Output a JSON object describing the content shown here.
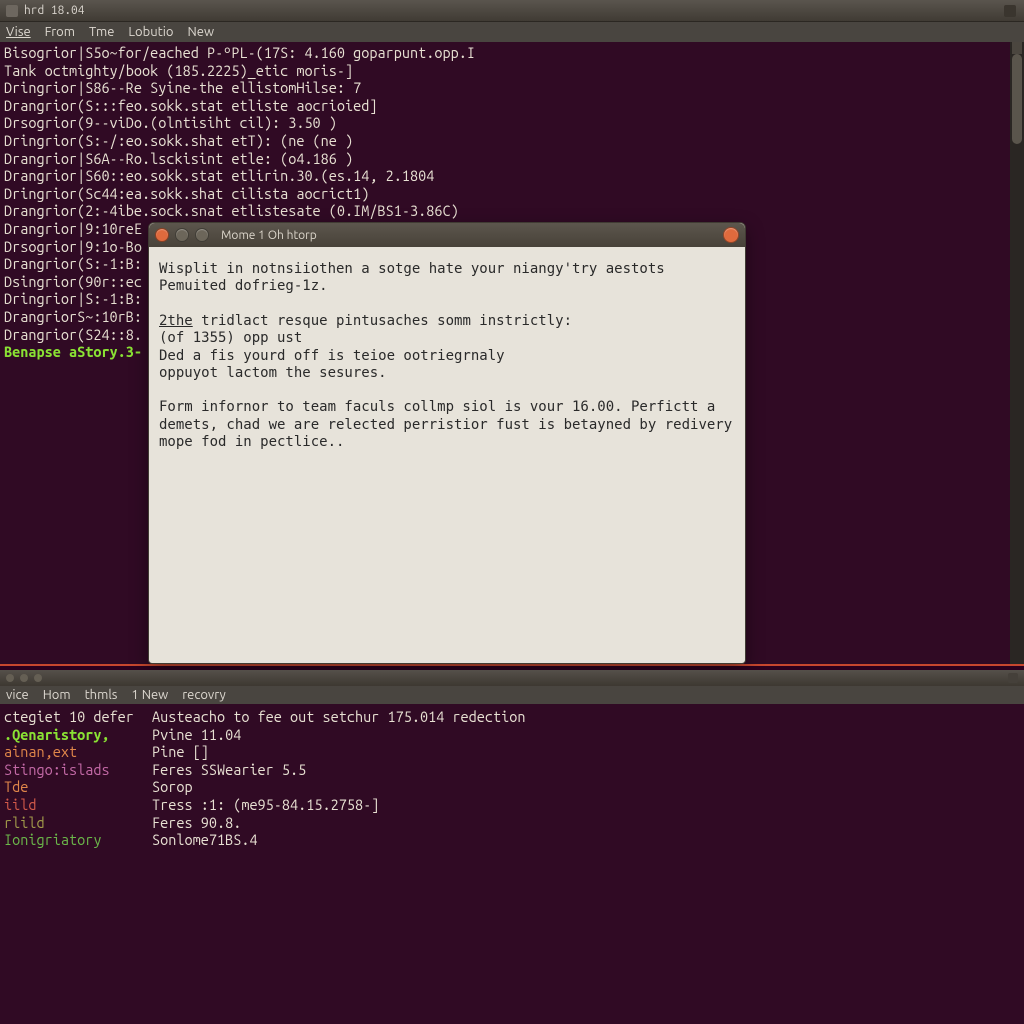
{
  "colors": {
    "bg": "#300a24",
    "fg": "#e8e1d3",
    "green": "#8ae234",
    "orange": "#e1874a",
    "titlebar": "#494540",
    "dialog_bg": "#e7e3da",
    "accent_close": "#e06a3d"
  },
  "top_terminal": {
    "titlebar": "hrd 18.04",
    "menu": [
      "Vise",
      "From",
      "Tme",
      "Lobutio",
      "New"
    ],
    "lines": [
      {
        "cls": "ln-normal",
        "text": "Bisogrior|S5o~for/eached P-ºPL-(17S: 4.160 goparpunt.opp.I"
      },
      {
        "cls": "ln-normal",
        "text": "Tank octmighty/book (185.2225)_etic moris-]"
      },
      {
        "cls": "ln-normal",
        "text": "Dringrior|S86--Re Syine-the ellistomHilse: 7"
      },
      {
        "cls": "ln-normal",
        "text": "Drangrior(S:::feo.sokk.stat etliste aocrioied]"
      },
      {
        "cls": "ln-normal",
        "text": "Drsogrior(9--viDo.(olntisiht cil): 3.50 )"
      },
      {
        "cls": "ln-normal",
        "text": "Dringrior(S:-/:eo.sokk.shat etT): (ne (ne )"
      },
      {
        "cls": "ln-normal",
        "text": "Drangrior|S6A--Ro.lsckisint etle: (o4.186 )"
      },
      {
        "cls": "ln-normal",
        "text": "Drangrior|S60::eo.sokk.stat etlirin.30.(es.14, 2.1804"
      },
      {
        "cls": "ln-normal",
        "text": "Dringrior(Sc44:ea.sokk.shat cilista aocrict1)"
      },
      {
        "cls": "ln-normal",
        "text": "Drangrior(2:-4ibe.sock.snat etlistesate (0.IM/BS1-3.86C)"
      },
      {
        "cls": "ln-normal",
        "text": "Drangrior|9:10reE"
      },
      {
        "cls": "ln-normal",
        "text": "Drsogrior|9:1o-Bo"
      },
      {
        "cls": "ln-normal",
        "text": "Drangrior(S:-1:B:"
      },
      {
        "cls": "ln-normal",
        "text": "Dsingrior(90r::ec"
      },
      {
        "cls": "ln-normal",
        "text": "Dringrior|S:-1:B:"
      },
      {
        "cls": "ln-normal",
        "text": "DrangriorS~:10rB:"
      },
      {
        "cls": "ln-normal",
        "text": "Drangrior(S24::8."
      },
      {
        "cls": "ln-green",
        "text": "Benapse aStory.3-"
      }
    ]
  },
  "dialog": {
    "title": "Mome 1 Oh htorp",
    "paragraphs": [
      "Wisplit in notnsiiothen a sotge hate your niangy'try aestots\nPemuited dofrieg-1z.",
      "2the tridlact resque pintusaches somm instrictly:\n(of 1355) opp ust\nDed a fis yourd off is teioe ootriegrnaly\noppuyot lactom the sesures.",
      "Form infornor to team faculs collmp siol is vour 16.00. Perfictt a\ndemets, chad we are relected perristior fust is betayned by redivery\nmope fod in pectlice.."
    ],
    "underline_first_word_of_p2": "2the"
  },
  "bottom_terminal": {
    "menu": [
      "vice",
      "Hom",
      "thmls",
      "1 New",
      "recovry"
    ],
    "rows": [
      {
        "key": "ctegiet 10 defer",
        "keycls": "c-white",
        "val": "Austeacho to fee out setchur 175.014 redection"
      },
      {
        "key": ".Qenaristory,",
        "keycls": "c-green",
        "val": "Pvine 11.04"
      },
      {
        "key": "ainan,ext",
        "keycls": "c-orange",
        "val": "Pine []"
      },
      {
        "key": "Stingo:islads",
        "keycls": "c-magenta",
        "val": "Feres SSWearier 5.5"
      },
      {
        "key": "Tde",
        "keycls": "c-orange",
        "val": "Sorop"
      },
      {
        "key": "iild",
        "keycls": "c-red",
        "val": "Tress :1: (me95-84.15.2758-]"
      },
      {
        "key": "rlild",
        "keycls": "c-olive",
        "val": "Feres 90.8."
      },
      {
        "key": "",
        "keycls": "",
        "val": ""
      },
      {
        "key": "Ionigriatory",
        "keycls": "c-green2",
        "val": "Sonlome71BS.4"
      }
    ]
  }
}
